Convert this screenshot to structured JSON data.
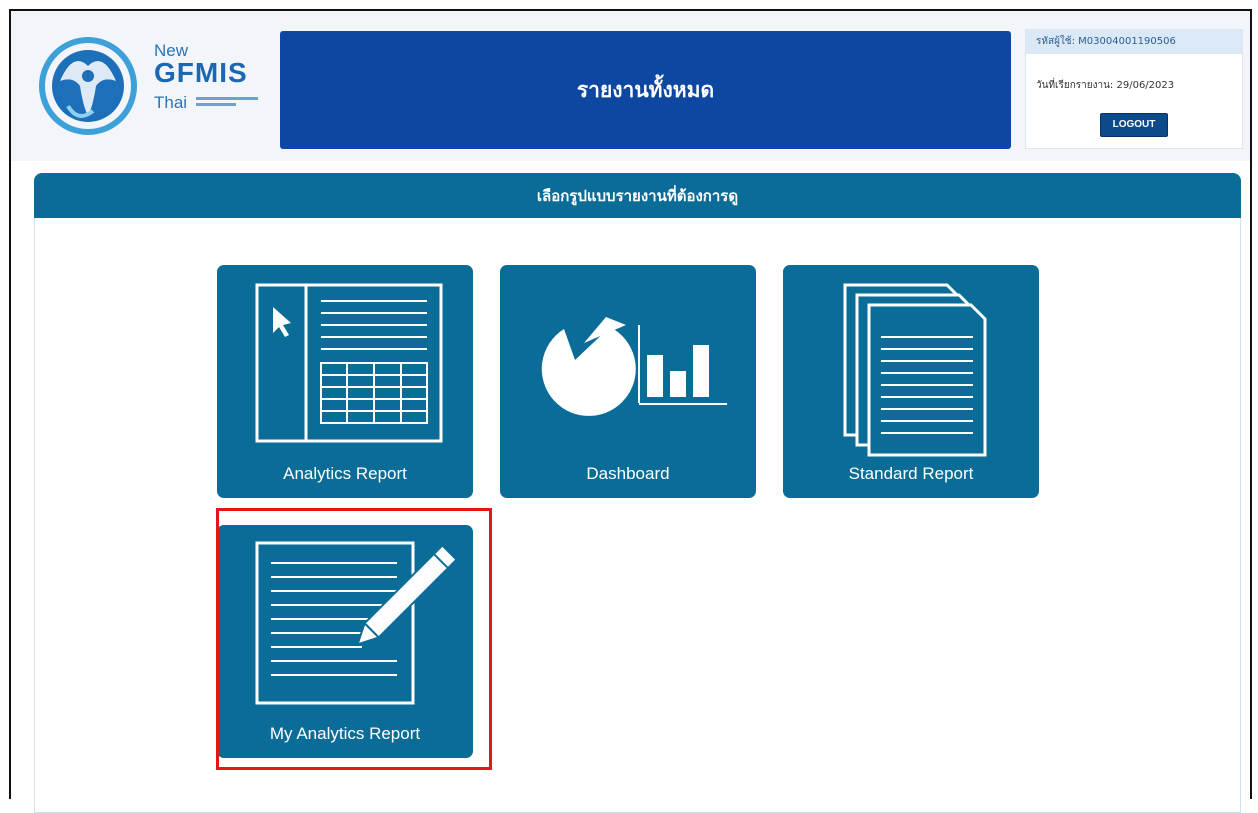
{
  "header": {
    "logo": {
      "new": "New",
      "gfmis": "GFMIS",
      "thai": "Thai"
    },
    "title": "รายงานทั้งหมด",
    "user_id_label": "รหัสผู้ใช้:",
    "user_id": "M03004001190506",
    "report_date_label": "วันที่เรียกรายงาน:",
    "report_date": "29/06/2023",
    "logout_label": "LOGOUT"
  },
  "panel": {
    "heading": "เลือกรูปแบบรายงานที่ต้องการดู"
  },
  "tiles": [
    {
      "label": "Analytics Report",
      "icon": "analytics-report-icon"
    },
    {
      "label": "Dashboard",
      "icon": "dashboard-chart-icon"
    },
    {
      "label": "Standard Report",
      "icon": "stacked-documents-icon"
    },
    {
      "label": "My Analytics Report",
      "icon": "document-pen-icon"
    }
  ],
  "colors": {
    "banner": "#0d47a1",
    "tile": "#0a6c97",
    "highlight": "#e3161b"
  }
}
